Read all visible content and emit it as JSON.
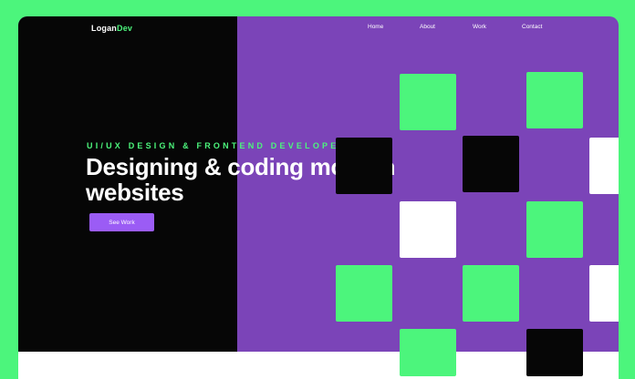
{
  "brand": {
    "logo_main": "Logan",
    "logo_accent": "Dev"
  },
  "nav": {
    "items": [
      "Home",
      "About",
      "Work",
      "Contact"
    ]
  },
  "hero": {
    "subtitle": "UI/UX DESIGN & FRONTEND DEVELOPER",
    "headline_line1": "Designing  & coding modern",
    "headline_line2": "websites",
    "cta_label": "See Work"
  },
  "colors": {
    "background": "#4cf57c",
    "left_panel": "#060606",
    "right_panel": "#7b44b8",
    "accent_green": "#4cf57c",
    "button_purple": "#9b5cf5",
    "white": "#ffffff"
  }
}
